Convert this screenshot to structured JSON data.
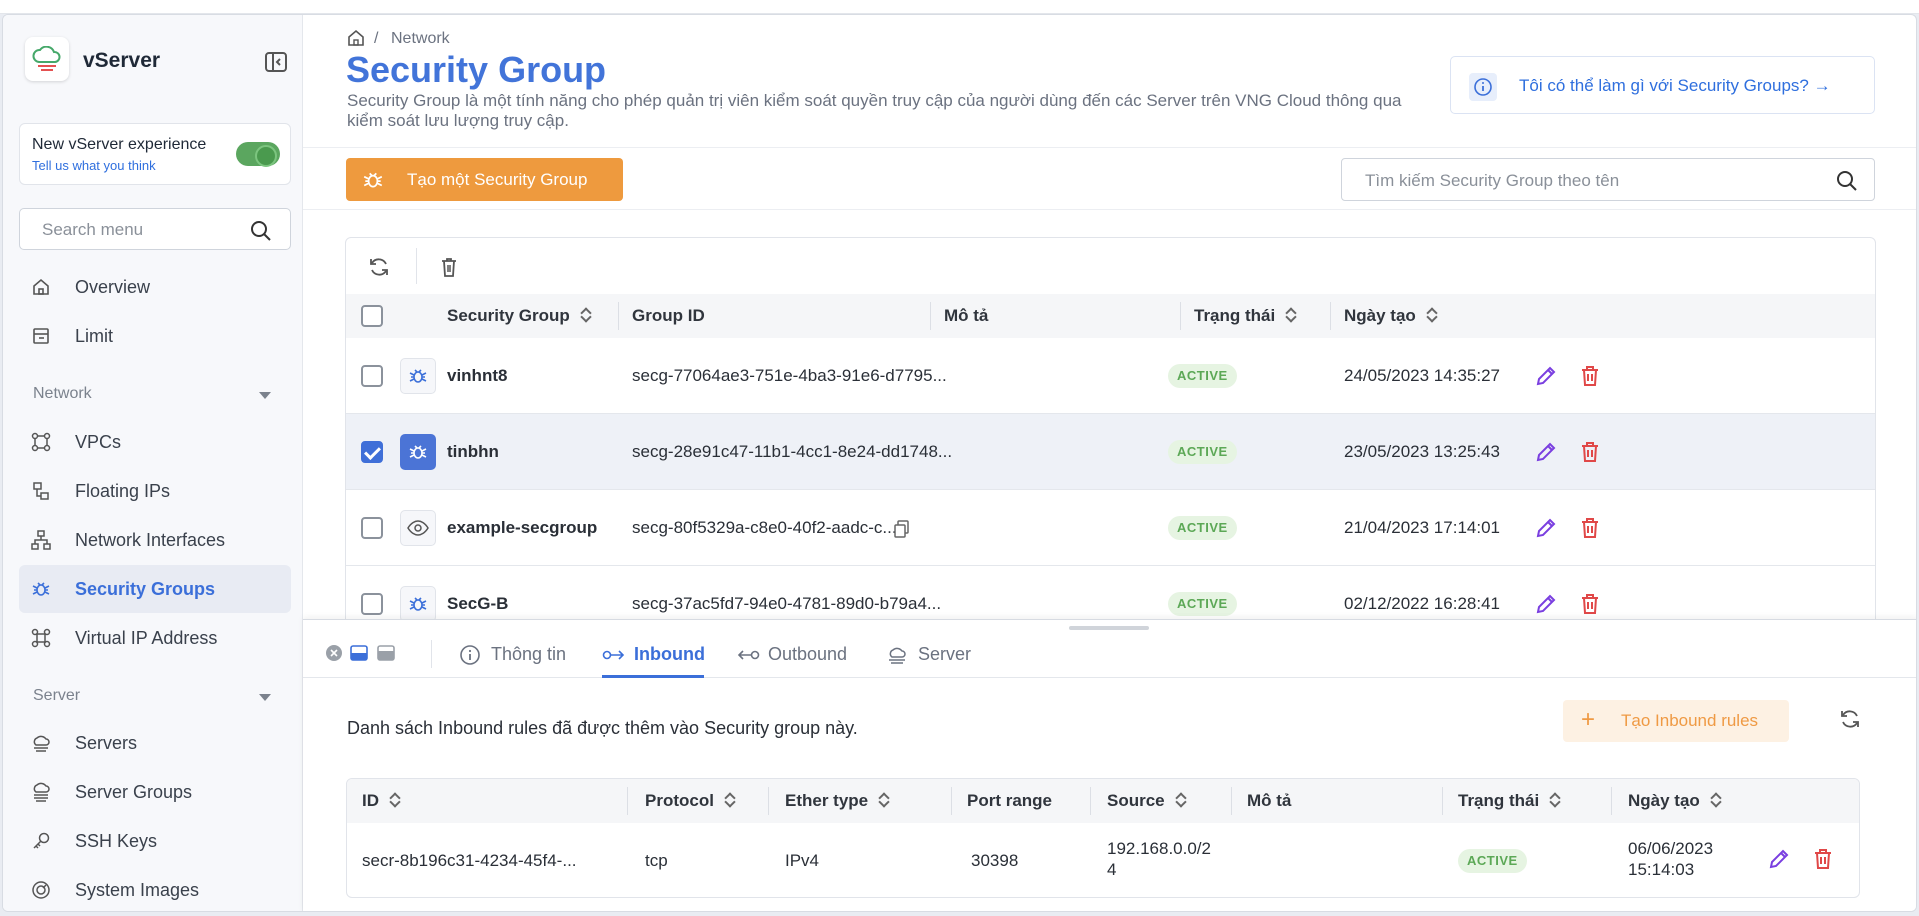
{
  "app": {
    "name": "vServer"
  },
  "sidebar": {
    "experience": {
      "title": "New vServer experience",
      "link": "Tell us what you think",
      "enabled": true
    },
    "search_placeholder": "Search menu",
    "items": [
      {
        "label": "Overview",
        "icon": "home-icon"
      },
      {
        "label": "Limit",
        "icon": "limit-icon"
      }
    ],
    "network_section": "Network",
    "network_items": [
      {
        "label": "VPCs",
        "icon": "vpc-icon"
      },
      {
        "label": "Floating IPs",
        "icon": "floating-ip-icon"
      },
      {
        "label": "Network Interfaces",
        "icon": "network-interface-icon"
      },
      {
        "label": "Security Groups",
        "icon": "security-group-icon",
        "active": true
      },
      {
        "label": "Virtual IP Address",
        "icon": "virtual-ip-icon"
      }
    ],
    "server_section": "Server",
    "server_items": [
      {
        "label": "Servers",
        "icon": "server-icon"
      },
      {
        "label": "Server Groups",
        "icon": "server-group-icon"
      },
      {
        "label": "SSH Keys",
        "icon": "key-icon"
      },
      {
        "label": "System Images",
        "icon": "disk-icon"
      }
    ]
  },
  "header": {
    "breadcrumb": {
      "separator": "/",
      "current": "Network"
    },
    "title": "Security Group",
    "description": "Security Group là một tính năng cho phép quản trị viên kiểm soát quyền truy cập của người dùng đến các Server trên VNG Cloud thông qua kiểm soát lưu lượng truy cập.",
    "help_text": "Tôi có thể làm gì với Security Groups? →",
    "create_button": "Tạo một Security Group",
    "search_placeholder": "Tìm kiếm Security Group theo tên"
  },
  "table": {
    "columns": [
      "Security Group",
      "Group ID",
      "Mô tả",
      "Trạng thái",
      "Ngày tạo"
    ],
    "rows": [
      {
        "name": "vinhnt8",
        "group_id": "secg-77064ae3-751e-4ba3-91e6-d7795...",
        "status": "ACTIVE",
        "created": "24/05/2023 14:35:27",
        "checked": false
      },
      {
        "name": "tinbhn",
        "group_id": "secg-28e91c47-11b1-4cc1-8e24-dd1748...",
        "status": "ACTIVE",
        "created": "23/05/2023 13:25:43",
        "checked": true
      },
      {
        "name": "example-secgroup",
        "group_id": "secg-80f5329a-c8e0-40f2-aadc-c...",
        "status": "ACTIVE",
        "created": "21/04/2023 17:14:01",
        "checked": false
      },
      {
        "name": "SecG-B",
        "group_id": "secg-37ac5fd7-94e0-4781-89d0-b79a4...",
        "status": "ACTIVE",
        "created": "02/12/2022 16:28:41",
        "checked": false
      }
    ]
  },
  "drawer": {
    "tabs": [
      {
        "label": "Thông tin",
        "icon": "info-icon"
      },
      {
        "label": "Inbound",
        "icon": "inbound-icon",
        "active": true
      },
      {
        "label": "Outbound",
        "icon": "outbound-icon"
      },
      {
        "label": "Server",
        "icon": "server-icon"
      }
    ],
    "description": "Danh sách Inbound rules đã được thêm vào Security group này.",
    "create_button": "Tạo Inbound rules",
    "columns": [
      "ID",
      "Protocol",
      "Ether type",
      "Port range",
      "Source",
      "Mô tả",
      "Trạng thái",
      "Ngày tạo"
    ],
    "rules": [
      {
        "id": "secr-8b196c31-4234-45f4-...",
        "protocol": "tcp",
        "ether_type": "IPv4",
        "port_range": "30398",
        "source_line1": "192.168.0.0/2",
        "source_line2": "4",
        "status": "ACTIVE",
        "created_line1": "06/06/2023",
        "created_line2": "15:14:03"
      }
    ]
  },
  "colors": {
    "accent": "#4274d9",
    "orange": "#ee9a3e",
    "active_badge": "#5ca856",
    "danger": "#e04848",
    "edit": "#7a3fe0"
  }
}
